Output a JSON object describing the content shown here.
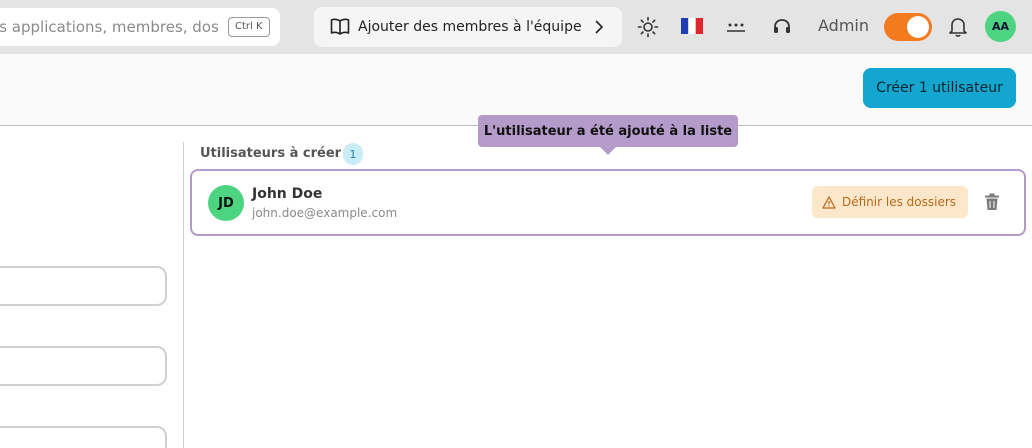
{
  "topbar": {
    "search": {
      "placeholder": "es applications, membres, dossiers",
      "shortcut": "Ctrl K"
    },
    "guide_button": {
      "label": "Ajouter des membres à l'équipe"
    },
    "icons": [
      "book-icon",
      "chevron-right-icon",
      "sun-icon",
      "flag-fr-icon",
      "password-icon",
      "support-headset-icon",
      "bell-icon"
    ],
    "admin_label": "Admin",
    "admin_toggle_on": true,
    "user_initials": "AA"
  },
  "header": {
    "create_button": "Créer 1 utilisateur"
  },
  "tooltip": {
    "text": "L'utilisateur a été ajouté à la liste"
  },
  "users_panel": {
    "title": "Utilisateurs à créer",
    "count": "1",
    "users": [
      {
        "initials": "JD",
        "name": "John Doe",
        "email": "john.doe@example.com",
        "folders_button": "Définir les dossiers"
      }
    ]
  },
  "colors": {
    "accent": "#14a6cf",
    "toggle": "#f37a1f",
    "avatar": "#4cd480",
    "tooltip": "#b49bc9",
    "warning_bg": "#fde7cb",
    "warning_text": "#b86a1a"
  }
}
